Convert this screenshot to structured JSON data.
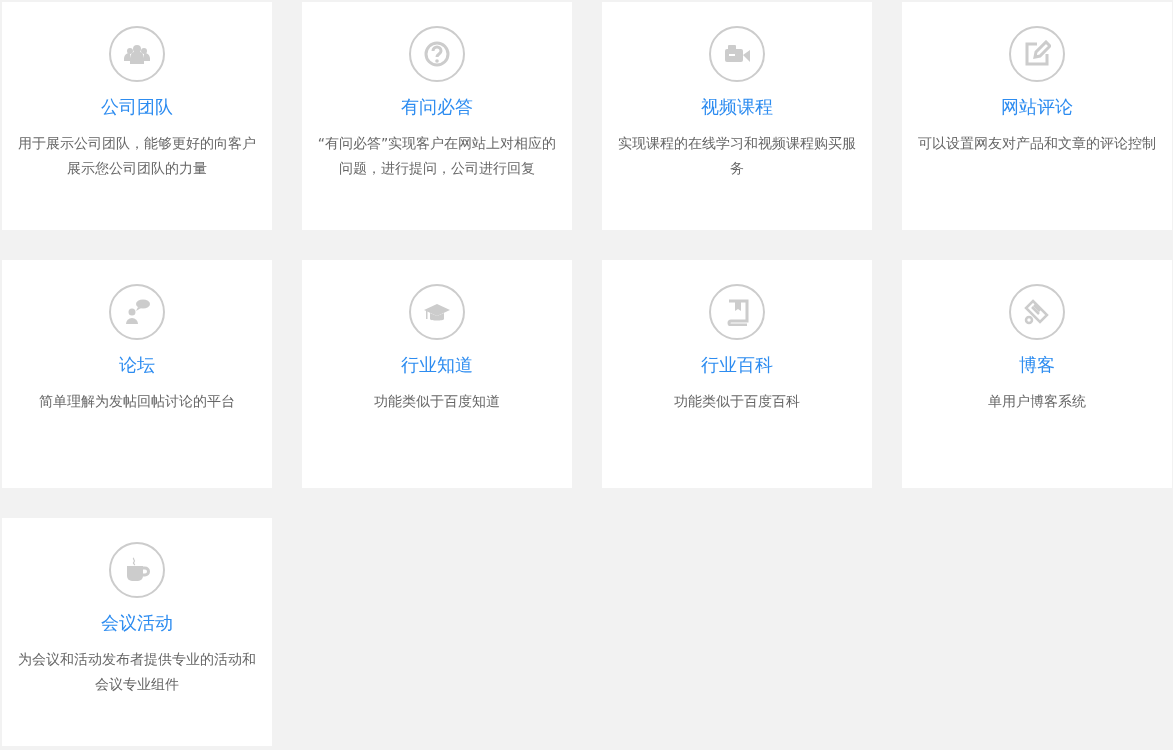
{
  "cards": [
    {
      "title": "公司团队",
      "description": "用于展示公司团队，能够更好的向客户展示您公司团队的力量"
    },
    {
      "title": "有问必答",
      "description": "“有问必答”实现客户在网站上对相应的问题，进行提问，公司进行回复"
    },
    {
      "title": "视频课程",
      "description": "实现课程的在线学习和视频课程购买服务"
    },
    {
      "title": "网站评论",
      "description": "可以设置网友对产品和文章的评论控制"
    },
    {
      "title": "论坛",
      "description": "简单理解为发帖回帖讨论的平台"
    },
    {
      "title": "行业知道",
      "description": "功能类似于百度知道"
    },
    {
      "title": "行业百科",
      "description": "功能类似于百度百科"
    },
    {
      "title": "博客",
      "description": "单用户博客系统"
    },
    {
      "title": "会议活动",
      "description": "为会议和活动发布者提供专业的活动和会议专业组件"
    }
  ]
}
